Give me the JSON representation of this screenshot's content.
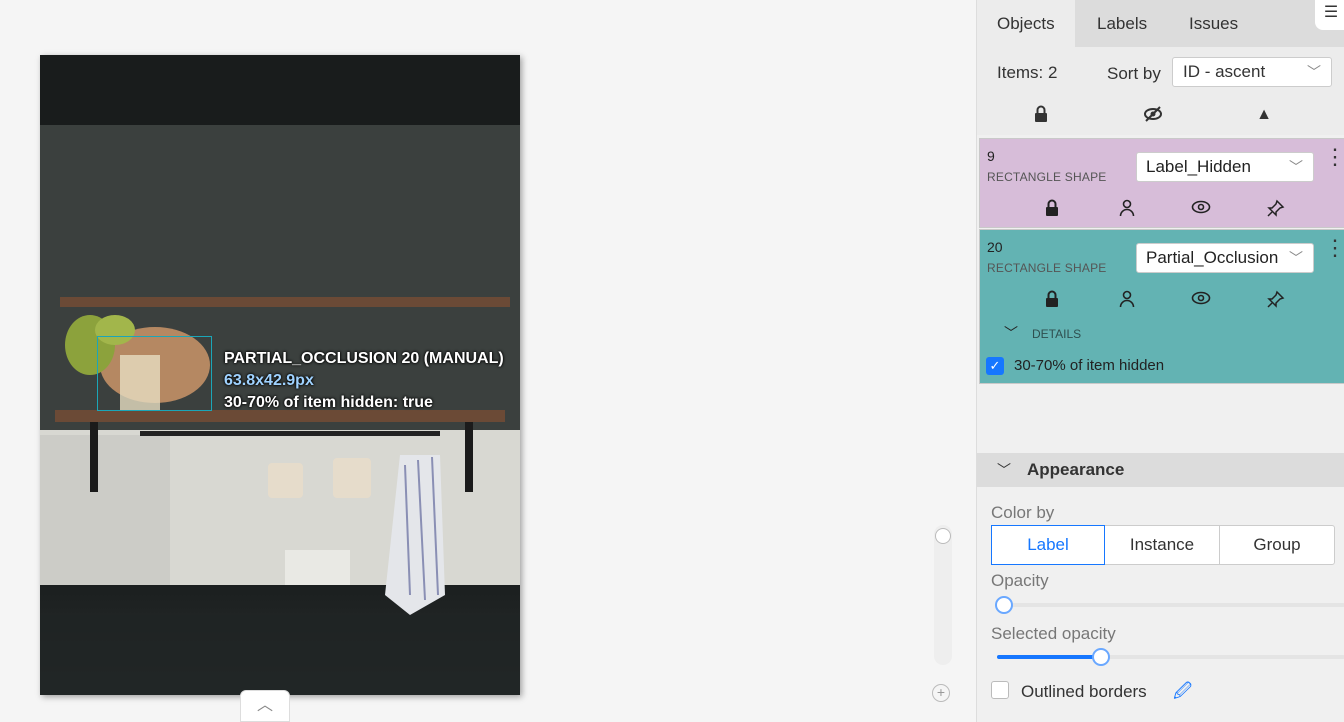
{
  "canvas": {
    "shape_label": {
      "title": "PARTIAL_OCCLUSION 20 (MANUAL)",
      "size": "63.8x42.9px",
      "attribute": "30-70% of item hidden: true"
    }
  },
  "sidebar": {
    "tabs": [
      {
        "label": "Objects",
        "active": true
      },
      {
        "label": "Labels",
        "active": false
      },
      {
        "label": "Issues",
        "active": false
      }
    ],
    "items_count": "Items: 2",
    "sort_label": "Sort by",
    "sort_value": "ID - ascent",
    "header_icons": [
      "lock-icon",
      "eye-slash-icon",
      "caret-up-icon"
    ],
    "objects": [
      {
        "id": "9",
        "type": "RECTANGLE SHAPE",
        "label": "Label_Hidden",
        "color": "#d7bdd9"
      },
      {
        "id": "20",
        "type": "RECTANGLE SHAPE",
        "label": "Partial_Occlusion",
        "color": "#63b3b3",
        "details_label": "DETAILS",
        "attribute_label": "30-70% of item hidden",
        "attribute_checked": true
      }
    ],
    "appearance": {
      "title": "Appearance",
      "color_by_label": "Color by",
      "color_by_options": [
        "Label",
        "Instance",
        "Group"
      ],
      "color_by_selected": "Label",
      "opacity_label": "Opacity",
      "opacity_value": 0.02,
      "selected_opacity_label": "Selected opacity",
      "selected_opacity_value": 0.3,
      "outlined_borders_label": "Outlined borders",
      "outlined_borders_checked": false
    }
  },
  "colors": {
    "accent": "#1677ff",
    "bbox": "#1ba6b8"
  }
}
